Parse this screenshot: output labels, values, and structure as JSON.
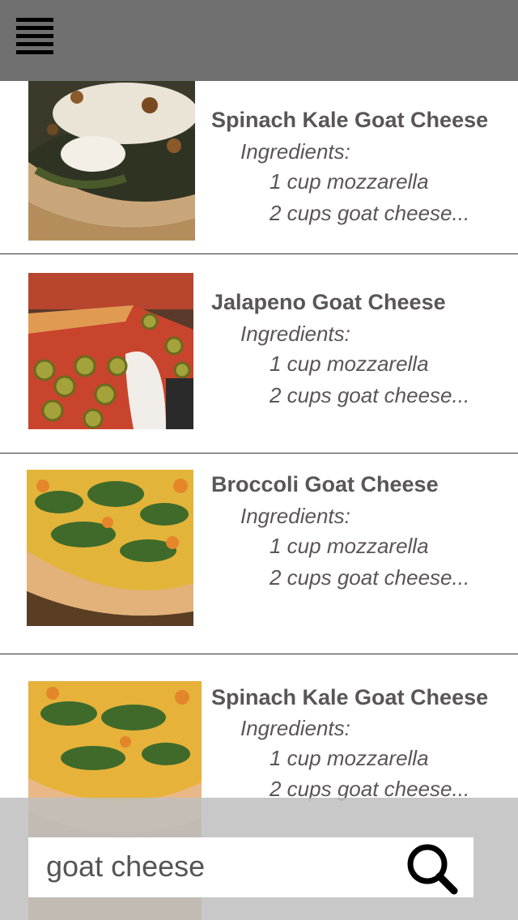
{
  "header": {
    "menu_icon": "hamburger-menu-icon"
  },
  "recipes": [
    {
      "title": "Spinach Kale Goat Cheese",
      "ingredients_label": "Ingredients:",
      "ingredients": [
        "1 cup mozzarella",
        "2 cups goat cheese..."
      ],
      "image": "spinach-kale-pizza"
    },
    {
      "title": "Jalapeno Goat Cheese",
      "ingredients_label": "Ingredients:",
      "ingredients": [
        "1 cup mozzarella",
        "2 cups goat cheese..."
      ],
      "image": "jalapeno-pizza"
    },
    {
      "title": "Broccoli Goat Cheese",
      "ingredients_label": "Ingredients:",
      "ingredients": [
        "1 cup mozzarella",
        "2 cups goat cheese..."
      ],
      "image": "broccoli-pizza"
    },
    {
      "title": "Spinach Kale Goat Cheese",
      "ingredients_label": "Ingredients:",
      "ingredients": [
        "1 cup mozzarella",
        "2 cups goat cheese..."
      ],
      "image": "cheesy-spinach-pizza"
    }
  ],
  "search": {
    "value": "goat cheese",
    "icon": "search-icon"
  },
  "colors": {
    "header_bg": "#707070",
    "text": "#5a5556",
    "search_overlay": "#bebebe"
  }
}
